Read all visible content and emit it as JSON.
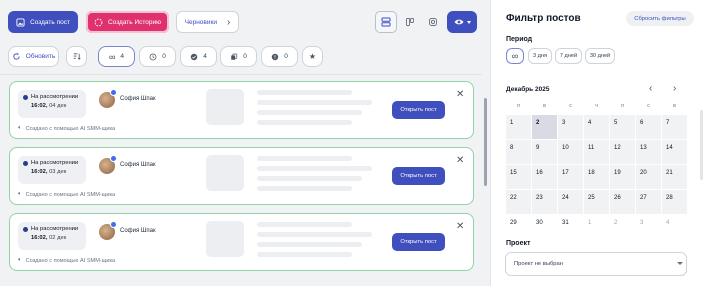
{
  "toolbar": {
    "create_post": "Создать пост",
    "create_story": "Создать Историю",
    "drafts": "Черновики"
  },
  "filters_bar": {
    "refresh": "Обновить",
    "counts": [
      "4",
      "0",
      "4",
      "0",
      "0"
    ]
  },
  "posts": [
    {
      "status": "На рассмотрении",
      "time": "16:02,",
      "date": "04 дек",
      "author": "София Шпак",
      "action": "Открыть пост",
      "note": "Создано с помощью AI SMM-щика"
    },
    {
      "status": "На рассмотрении",
      "time": "16:02,",
      "date": "03 дек",
      "author": "София Шпак",
      "action": "Открыть пост",
      "note": "Создано с помощью AI SMM-щика"
    },
    {
      "status": "На рассмотрении",
      "time": "16:02,",
      "date": "02 дек",
      "author": "София Шпак",
      "action": "Открыть пост",
      "note": "Создано с помощью AI SMM-щика"
    }
  ],
  "panel": {
    "title": "Фильтр постов",
    "reset": "Сбросить фильтры",
    "period_label": "Период",
    "periods": [
      "3 дня",
      "7 дней",
      "30 дней"
    ],
    "month": "Декабрь 2025",
    "weekdays": [
      "п",
      "в",
      "с",
      "ч",
      "п",
      "с",
      "в"
    ],
    "weeks": [
      [
        "1",
        "2",
        "3",
        "4",
        "5",
        "6",
        "7"
      ],
      [
        "8",
        "9",
        "10",
        "11",
        "12",
        "13",
        "14"
      ],
      [
        "15",
        "16",
        "17",
        "18",
        "19",
        "20",
        "21"
      ],
      [
        "22",
        "23",
        "24",
        "25",
        "26",
        "27",
        "28"
      ],
      [
        "29",
        "30",
        "31",
        "1",
        "2",
        "3",
        "4"
      ]
    ],
    "project_label": "Проект",
    "project_placeholder": "Проект не выбран"
  },
  "colors": {
    "primary": "#3f4fbe",
    "pink": "#e0316f",
    "card_border": "#8fd3a7"
  }
}
